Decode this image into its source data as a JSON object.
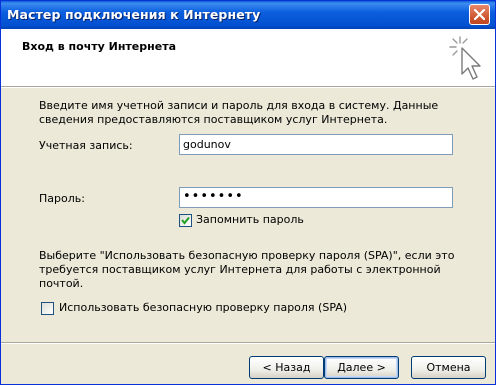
{
  "window": {
    "title": "Мастер подключения к Интернету"
  },
  "header": {
    "title": "Вход в почту Интернета",
    "icon": "wizard-sparkle-cursor-icon"
  },
  "main": {
    "intro": "Введите имя учетной записи и пароль для входа в систему. Данные сведения предоставляются поставщиком услуг Интернета.",
    "account_label": "Учетная запись:",
    "account_value": "godunov",
    "password_label": "Пароль:",
    "password_value": "•••••••",
    "remember_label": "Запомнить пароль",
    "remember_checked": true,
    "spa_text": "Выберите \"Использовать безопасную проверку пароля (SPA)\", если это требуется поставщиком услуг Интернета для работы с электронной почтой.",
    "spa_label": "Использовать безопасную проверку пароля (SPA)",
    "spa_checked": false
  },
  "buttons": {
    "back": "< Назад",
    "next": "Далее >",
    "cancel": "Отмена"
  },
  "colors": {
    "titlebar": "#0350d0",
    "dialog_bg": "#ece9d8",
    "check": "#21a121"
  }
}
